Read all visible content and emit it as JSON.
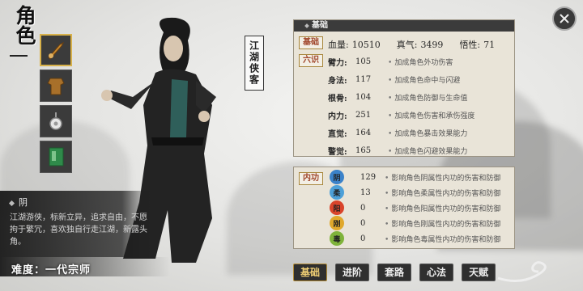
{
  "screen_title": "角色",
  "character_tag": "江湖侠客",
  "description": {
    "name": "阴",
    "text": "江湖游侠，标新立异，追求自由，不愿拘于繁冗，喜欢独自行走江湖，新露头角。"
  },
  "difficulty": "难度：一代宗师",
  "equipment_slots": [
    {
      "icon": "weapon-icon",
      "active": true
    },
    {
      "icon": "armor-icon",
      "active": false
    },
    {
      "icon": "amulet-icon",
      "active": false
    },
    {
      "icon": "book-icon",
      "active": false
    }
  ],
  "stats_panel": {
    "header": "基础",
    "basic_chip": "基础",
    "six_chip": "六识",
    "hp_label": "血量:",
    "hp": "10510",
    "qi_label": "真气:",
    "qi": "3499",
    "wx_label": "悟性:",
    "wx": "71",
    "rows": [
      {
        "name": "臂力:",
        "value": "105",
        "note": "加成角色外功伤害"
      },
      {
        "name": "身法:",
        "value": "117",
        "note": "加成角色命中与闪避"
      },
      {
        "name": "根骨:",
        "value": "104",
        "note": "加成角色防御与生命值"
      },
      {
        "name": "内力:",
        "value": "251",
        "note": "加成角色伤害和承伤强度"
      },
      {
        "name": "直觉:",
        "value": "164",
        "note": "加成角色暴击效果能力"
      },
      {
        "name": "警觉:",
        "value": "165",
        "note": "加成角色闪避效果能力"
      }
    ]
  },
  "neigong_panel": {
    "chip": "内功",
    "rows": [
      {
        "element": "阴",
        "color": "#3b82c9",
        "value": "129",
        "note": "影响角色阴属性内功的伤害和防御"
      },
      {
        "element": "柔",
        "color": "#4da0d8",
        "value": "13",
        "note": "影响角色柔属性内功的伤害和防御"
      },
      {
        "element": "阳",
        "color": "#d9442b",
        "value": "0",
        "note": "影响角色阳属性内功的伤害和防御"
      },
      {
        "element": "刚",
        "color": "#e0a82c",
        "value": "0",
        "note": "影响角色刚属性内功的伤害和防御"
      },
      {
        "element": "毒",
        "color": "#7fb33a",
        "value": "0",
        "note": "影响角色毒属性内功的伤害和防御"
      }
    ]
  },
  "tabs": [
    {
      "label": "基础",
      "active": true
    },
    {
      "label": "进阶",
      "active": false
    },
    {
      "label": "套路",
      "active": false
    },
    {
      "label": "心法",
      "active": false
    },
    {
      "label": "天赋",
      "active": false
    }
  ]
}
